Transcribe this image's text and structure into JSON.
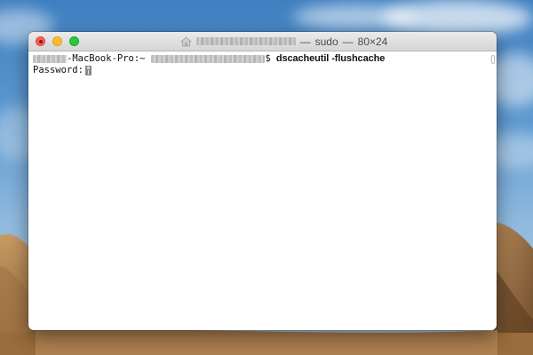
{
  "window": {
    "title_process": "sudo",
    "title_size": "80×24",
    "title_separator": "—",
    "title_user": "redacted",
    "controls": [
      "close-button",
      "minimize-button",
      "zoom-button"
    ]
  },
  "terminal": {
    "host_redacted": "redacted",
    "host_suffix": "-MacBook-Pro:~",
    "user_redacted": "redacted",
    "prompt_symbol": "$",
    "command": "dscacheutil -flushcache",
    "password_label": "Password:"
  },
  "colors": {
    "close": "#fc5f57",
    "minimize": "#fdbc2e",
    "zoom": "#28c840",
    "terminal_bg": "#ffffff",
    "terminal_text": "#111111"
  },
  "icons": [
    "home-icon",
    "key-icon"
  ]
}
